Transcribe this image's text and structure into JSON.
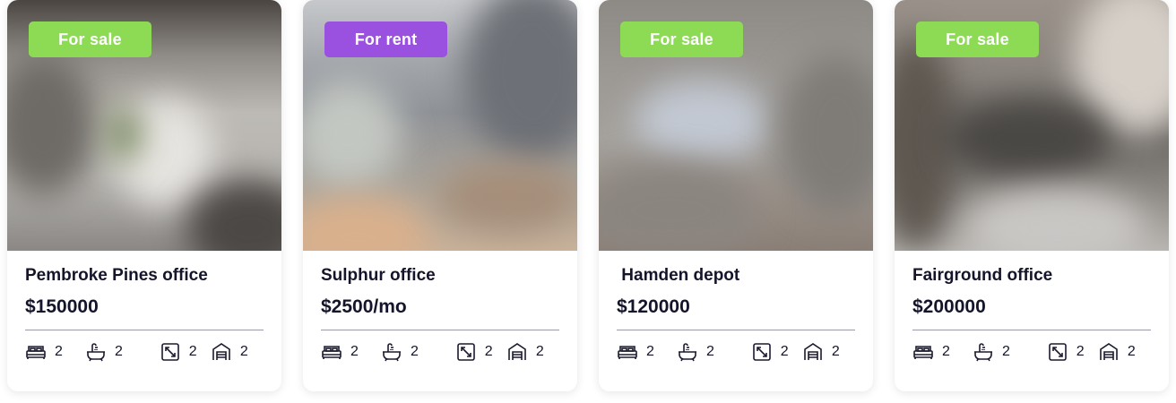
{
  "listings": [
    {
      "status": "For sale",
      "status_color": "#8ddb55",
      "title": "Pembroke Pines office",
      "price": "$150000",
      "bedrooms": "2",
      "bathrooms": "2",
      "area": "2",
      "garage": "2"
    },
    {
      "status": "For rent",
      "status_color": "#9b51e0",
      "title": "Sulphur office",
      "price": "$2500/mo",
      "bedrooms": "2",
      "bathrooms": "2",
      "area": "2",
      "garage": "2"
    },
    {
      "status": "For sale",
      "status_color": "#8ddb55",
      "title": " Hamden depot",
      "price": "$120000",
      "bedrooms": "2",
      "bathrooms": "2",
      "area": "2",
      "garage": "2"
    },
    {
      "status": "For sale",
      "status_color": "#8ddb55",
      "title": "Fairground office",
      "price": "$200000",
      "bedrooms": "2",
      "bathrooms": "2",
      "area": "2",
      "garage": "2"
    }
  ],
  "icons": {
    "bed": "bed-icon",
    "bath": "bathtub-icon",
    "area": "area-resize-icon",
    "garage": "garage-icon"
  }
}
